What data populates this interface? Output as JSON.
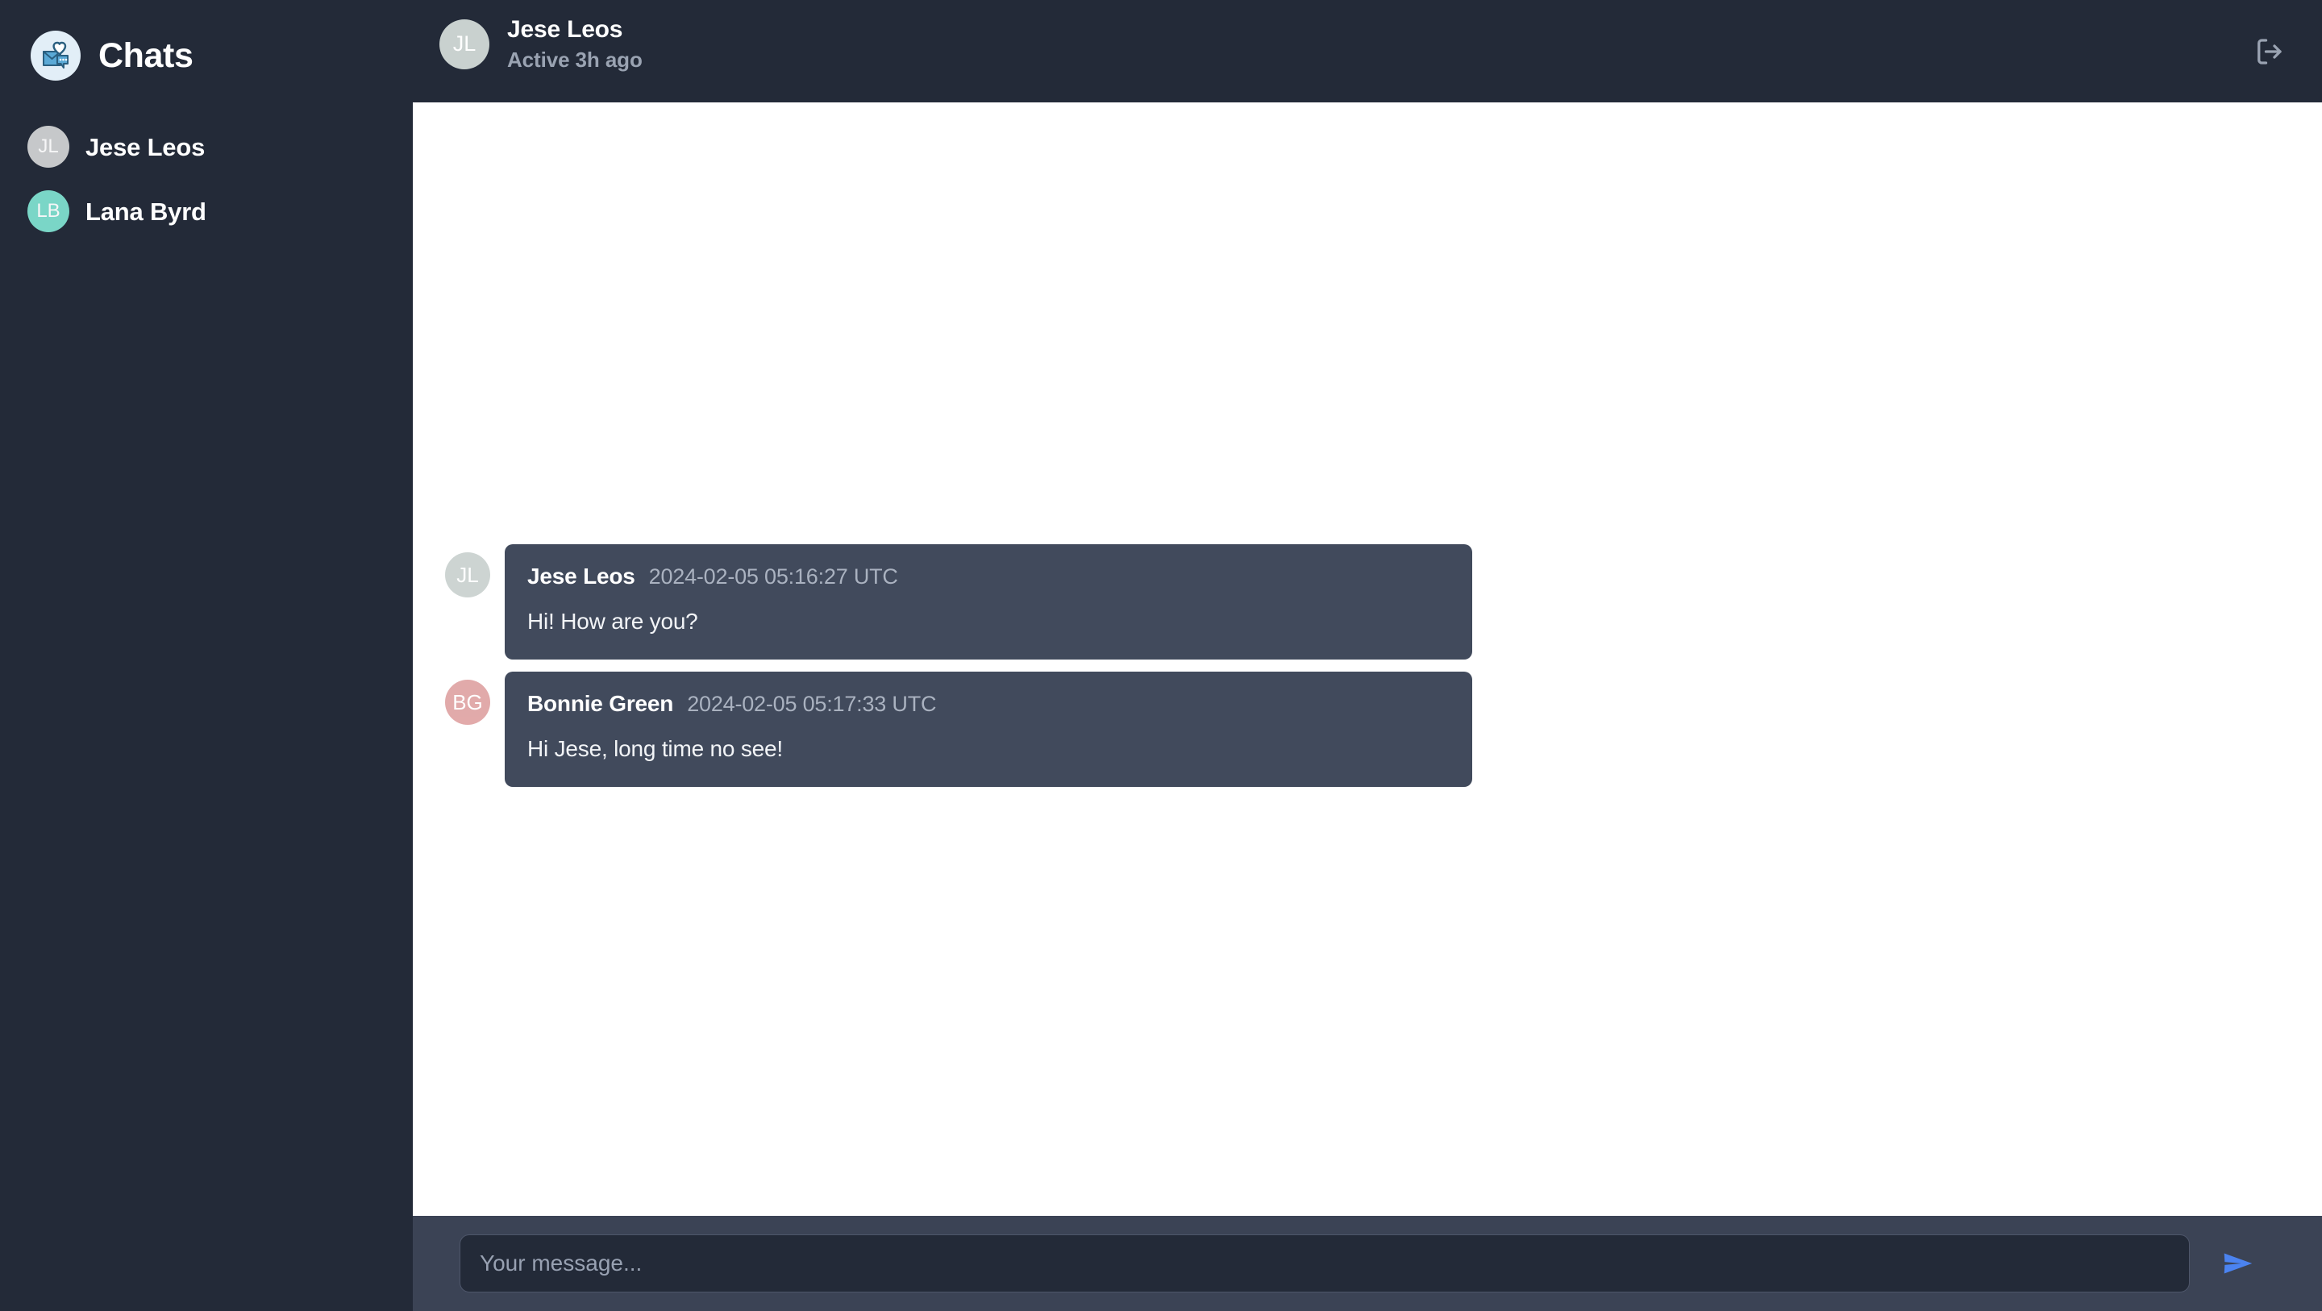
{
  "theme": {
    "sidebar_bg": "#232a38",
    "header_bg": "#232a38",
    "chat_bg": "#ffffff",
    "bubble_bg": "#414a5c",
    "composer_bg": "#3b4355",
    "input_bg": "#232a38",
    "accent": "#4b83f0",
    "logo_bg": "#e2eef7",
    "logo_fg": "#5aa9d6",
    "logo_stroke": "#2a5f80"
  },
  "sidebar": {
    "brand": {
      "title": "Chats",
      "logo_icon": "mail-heart-chat-icon"
    },
    "contacts": [
      {
        "name": "Jese Leos",
        "initials": "JL",
        "color": "#cdcfd0"
      },
      {
        "name": "Lana Byrd",
        "initials": "LB",
        "color": "#7eddcd"
      }
    ]
  },
  "header": {
    "peer_initials": "JL",
    "peer_name": "Jese Leos",
    "peer_status": "Active 3h ago",
    "logout_icon": "logout-icon"
  },
  "messages": [
    {
      "sender": "Jese Leos",
      "initials": "JL",
      "avatar_color": "#c9d1cf",
      "timestamp": "2024-02-05 05:16:27 UTC",
      "text": "Hi! How are you?"
    },
    {
      "sender": "Bonnie Green",
      "initials": "BG",
      "avatar_color": "#dfa3a3",
      "timestamp": "2024-02-05 05:17:33 UTC",
      "text": "Hi Jese, long time no see!"
    }
  ],
  "composer": {
    "placeholder": "Your message...",
    "value": "",
    "send_icon": "send-paper-plane-icon"
  }
}
